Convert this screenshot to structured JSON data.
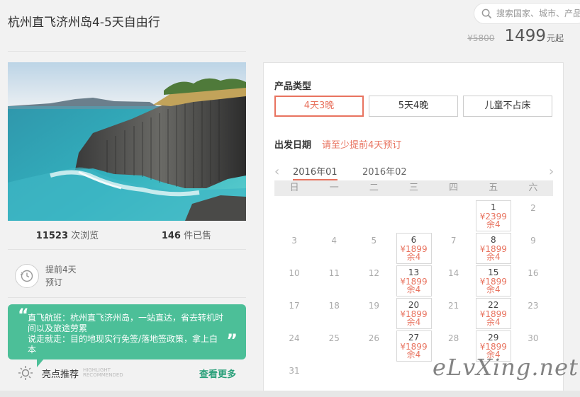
{
  "header": {
    "title": "杭州直飞济州岛4-5天自由行",
    "search_placeholder": "搜索国家、城市、产品",
    "old_price": "¥5800",
    "price": "1499",
    "price_unit": "元起"
  },
  "left": {
    "views_count": "11523",
    "views_label": "次浏览",
    "sold_count": "146",
    "sold_label": "件已售",
    "advance_line1": "提前4天",
    "advance_line2": "预订",
    "highlight_text_1": "直飞航班：杭州直飞济州岛，一站直达，省去转机时",
    "highlight_text_2": "间以及旅途劳累",
    "highlight_text_3": "说走就走：目的地现实行免签/落地签政策，拿上白本",
    "highlight_title": "亮点推荐",
    "highlight_en_1": "HIGHLIGHT",
    "highlight_en_2": "RECOMMENDED",
    "see_more": "查看更多"
  },
  "product_type": {
    "label": "产品类型",
    "options": [
      "4天3晚",
      "5天4晚",
      "儿童不占床"
    ],
    "selected": "4天3晚"
  },
  "departure": {
    "label": "出发日期",
    "notice": "请至少提前4天预订",
    "months": [
      "2016年01",
      "2016年02"
    ],
    "active_month": "2016年01",
    "weekdays": [
      "日",
      "一",
      "二",
      "三",
      "四",
      "五",
      "六"
    ],
    "days": [
      {
        "day": "1",
        "col": 5,
        "row": 0,
        "price": "¥2399",
        "remain": "余4"
      },
      {
        "day": "2",
        "col": 6,
        "row": 0
      },
      {
        "day": "3",
        "col": 0,
        "row": 1
      },
      {
        "day": "4",
        "col": 1,
        "row": 1
      },
      {
        "day": "5",
        "col": 2,
        "row": 1
      },
      {
        "day": "6",
        "col": 3,
        "row": 1,
        "price": "¥1899",
        "remain": "余4"
      },
      {
        "day": "7",
        "col": 4,
        "row": 1
      },
      {
        "day": "8",
        "col": 5,
        "row": 1,
        "price": "¥1899",
        "remain": "余4"
      },
      {
        "day": "9",
        "col": 6,
        "row": 1
      },
      {
        "day": "10",
        "col": 0,
        "row": 2
      },
      {
        "day": "11",
        "col": 1,
        "row": 2
      },
      {
        "day": "12",
        "col": 2,
        "row": 2
      },
      {
        "day": "13",
        "col": 3,
        "row": 2,
        "price": "¥1899",
        "remain": "余4"
      },
      {
        "day": "14",
        "col": 4,
        "row": 2
      },
      {
        "day": "15",
        "col": 5,
        "row": 2,
        "price": "¥1899",
        "remain": "余4"
      },
      {
        "day": "16",
        "col": 6,
        "row": 2
      },
      {
        "day": "17",
        "col": 0,
        "row": 3
      },
      {
        "day": "18",
        "col": 1,
        "row": 3
      },
      {
        "day": "19",
        "col": 2,
        "row": 3
      },
      {
        "day": "20",
        "col": 3,
        "row": 3,
        "price": "¥1899",
        "remain": "余4"
      },
      {
        "day": "21",
        "col": 4,
        "row": 3
      },
      {
        "day": "22",
        "col": 5,
        "row": 3,
        "price": "¥1899",
        "remain": "余4"
      },
      {
        "day": "23",
        "col": 6,
        "row": 3
      },
      {
        "day": "24",
        "col": 0,
        "row": 4
      },
      {
        "day": "25",
        "col": 1,
        "row": 4
      },
      {
        "day": "26",
        "col": 2,
        "row": 4
      },
      {
        "day": "27",
        "col": 3,
        "row": 4,
        "price": "¥1899",
        "remain": "余4"
      },
      {
        "day": "28",
        "col": 4,
        "row": 4
      },
      {
        "day": "29",
        "col": 5,
        "row": 4,
        "price": "¥1899",
        "remain": "余4"
      },
      {
        "day": "30",
        "col": 6,
        "row": 4
      },
      {
        "day": "31",
        "col": 0,
        "row": 5
      }
    ]
  },
  "watermark": "eLvXing.net",
  "colors": {
    "accent": "#e8735f",
    "green": "#4cbf98",
    "see_more": "#2aa07a"
  }
}
